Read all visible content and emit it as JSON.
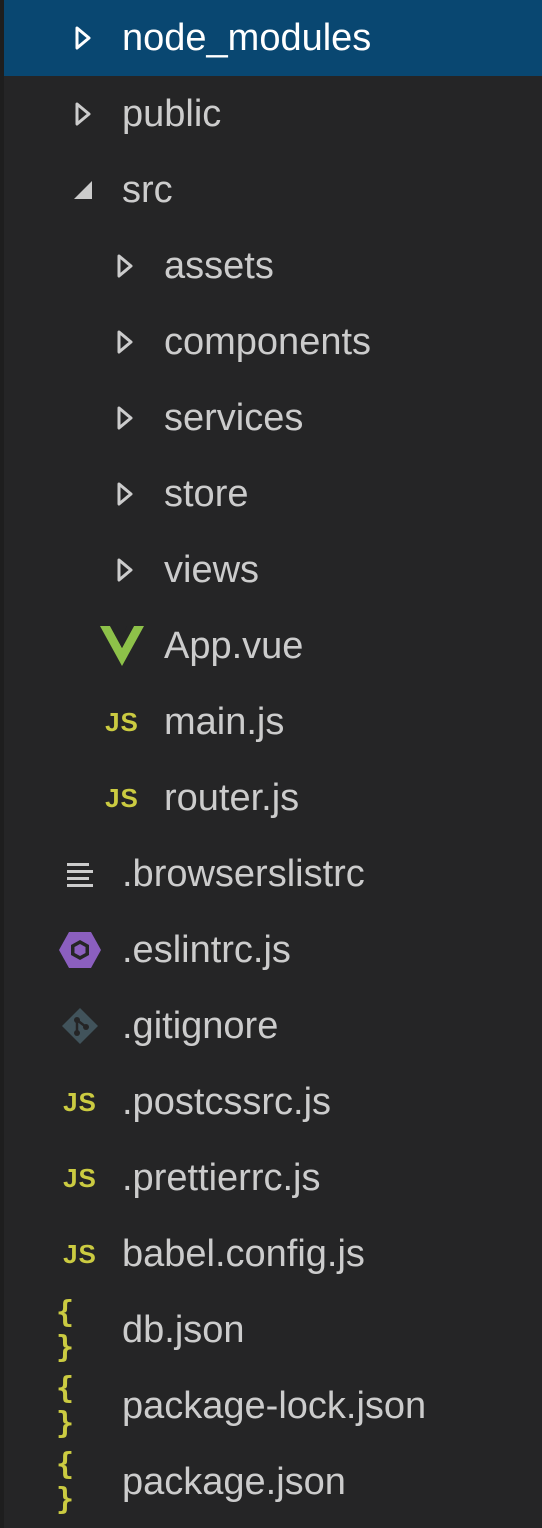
{
  "explorer": {
    "colors": {
      "background": "#252526",
      "selected": "#094771",
      "text": "#cccccc",
      "js": "#cbcb41",
      "json": "#cbcb41",
      "vue": "#8dc149",
      "eslint": "#8b5fbf",
      "git": "#41535b"
    },
    "items": [
      {
        "label": "node_modules",
        "type": "folder",
        "expanded": false,
        "selected": true
      },
      {
        "label": "public",
        "type": "folder",
        "expanded": false
      },
      {
        "label": "src",
        "type": "folder",
        "expanded": true
      },
      {
        "label": "assets",
        "type": "folder",
        "expanded": false
      },
      {
        "label": "components",
        "type": "folder",
        "expanded": false
      },
      {
        "label": "services",
        "type": "folder",
        "expanded": false
      },
      {
        "label": "store",
        "type": "folder",
        "expanded": false
      },
      {
        "label": "views",
        "type": "folder",
        "expanded": false
      },
      {
        "label": "App.vue",
        "type": "file",
        "icon": "vue-icon"
      },
      {
        "label": "main.js",
        "type": "file",
        "icon": "js-icon",
        "icon_text": "JS"
      },
      {
        "label": "router.js",
        "type": "file",
        "icon": "js-icon",
        "icon_text": "JS"
      },
      {
        "label": ".browserslistrc",
        "type": "file",
        "icon": "lines-icon"
      },
      {
        "label": ".eslintrc.js",
        "type": "file",
        "icon": "eslint-icon"
      },
      {
        "label": ".gitignore",
        "type": "file",
        "icon": "git-icon"
      },
      {
        "label": ".postcssrc.js",
        "type": "file",
        "icon": "js-icon",
        "icon_text": "JS"
      },
      {
        "label": ".prettierrc.js",
        "type": "file",
        "icon": "js-icon",
        "icon_text": "JS"
      },
      {
        "label": "babel.config.js",
        "type": "file",
        "icon": "js-icon",
        "icon_text": "JS"
      },
      {
        "label": "db.json",
        "type": "file",
        "icon": "json-icon",
        "icon_text": "{ }"
      },
      {
        "label": "package-lock.json",
        "type": "file",
        "icon": "json-icon",
        "icon_text": "{ }"
      },
      {
        "label": "package.json",
        "type": "file",
        "icon": "json-icon",
        "icon_text": "{ }"
      }
    ]
  }
}
